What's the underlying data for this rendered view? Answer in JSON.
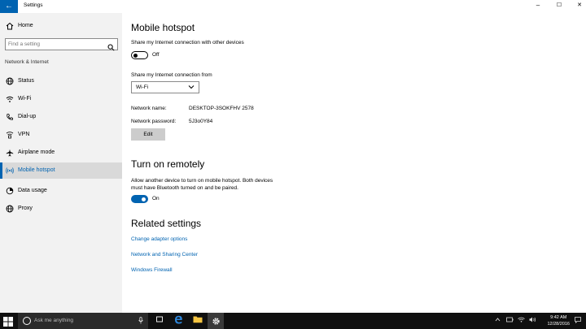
{
  "window": {
    "title": "Settings",
    "back_glyph": "←",
    "minimize_glyph": "–",
    "maximize_glyph": "☐",
    "close_glyph": "✕"
  },
  "sidebar": {
    "home": {
      "label": "Home",
      "icon": "home-icon"
    },
    "search_placeholder": "Find a setting",
    "section_title": "Network & Internet",
    "items": [
      {
        "label": "Status",
        "icon": "globe-icon"
      },
      {
        "label": "Wi-Fi",
        "icon": "wifi-icon"
      },
      {
        "label": "Dial-up",
        "icon": "phone-icon"
      },
      {
        "label": "VPN",
        "icon": "vpn-icon"
      },
      {
        "label": "Airplane mode",
        "icon": "airplane-icon"
      },
      {
        "label": "Mobile hotspot",
        "icon": "hotspot-icon",
        "active": true
      },
      {
        "label": "Data usage",
        "icon": "data-usage-icon"
      },
      {
        "label": "Proxy",
        "icon": "proxy-icon"
      }
    ]
  },
  "main": {
    "title": "Mobile hotspot",
    "share_label": "Share my Internet connection with other devices",
    "share_toggle": {
      "state": "Off"
    },
    "share_from_label": "Share my Internet connection from",
    "share_from_value": "Wi-Fi",
    "network_name_label": "Network name:",
    "network_name_value": "DESKTOP-3SOKFHV 2578",
    "network_password_label": "Network password:",
    "network_password_value": "5J3o0Y84",
    "edit_label": "Edit",
    "remote_title": "Turn on remotely",
    "remote_desc_1": "Allow another device to turn on mobile hotspot. Both devices",
    "remote_desc_2": "must have Bluetooth turned on and be paired.",
    "remote_toggle": {
      "state": "On"
    },
    "related_title": "Related settings",
    "links": [
      "Change adapter options",
      "Network and Sharing Center",
      "Windows Firewall"
    ]
  },
  "taskbar": {
    "search_placeholder": "Ask me anything",
    "time": "9:42 AM",
    "date": "12/28/2016",
    "accent": "#0063b1"
  }
}
